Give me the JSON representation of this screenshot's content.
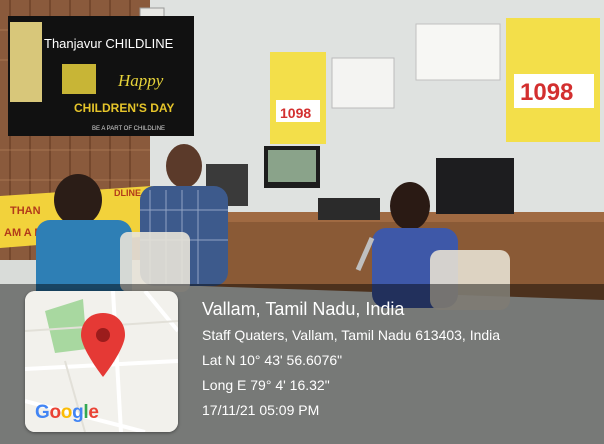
{
  "banner": {
    "title": "Thanjavur CHILDLINE",
    "greeting": "Happy",
    "event": "CHILDREN'S DAY",
    "tagline": "BE A PART OF CHILDLINE",
    "logo_text": "CHILD LINE",
    "side_text_1": "THAN",
    "side_text_2": "AM A FR",
    "side_text_3": "DLINE"
  },
  "posters": {
    "helpline_number": "1098",
    "helpline_number_2": "1098"
  },
  "geotag": {
    "place": "Vallam, Tamil Nadu, India",
    "address": "Staff Quaters, Vallam, Tamil Nadu 613403, India",
    "latitude": "Lat N 10° 43' 56.6076\"",
    "longitude": "Long E 79° 4' 16.32\"",
    "datetime": "17/11/21 05:09 PM"
  },
  "map": {
    "logo": "Google",
    "pin_color": "#e53935",
    "pin_icon": "map-pin-icon"
  }
}
